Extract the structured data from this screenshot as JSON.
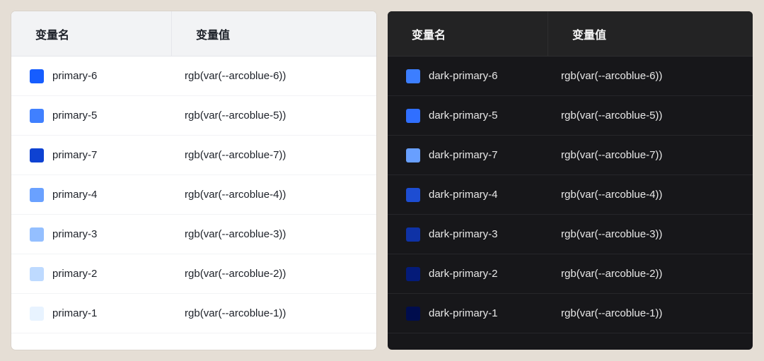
{
  "headers": {
    "var_name": "变量名",
    "var_value": "变量值"
  },
  "light": {
    "rows": [
      {
        "name": "primary-6",
        "value": "rgb(var(--arcoblue-6))",
        "swatch": "#165dff"
      },
      {
        "name": "primary-5",
        "value": "rgb(var(--arcoblue-5))",
        "swatch": "#4080ff"
      },
      {
        "name": "primary-7",
        "value": "rgb(var(--arcoblue-7))",
        "swatch": "#0e42d2"
      },
      {
        "name": "primary-4",
        "value": "rgb(var(--arcoblue-4))",
        "swatch": "#6aa1ff"
      },
      {
        "name": "primary-3",
        "value": "rgb(var(--arcoblue-3))",
        "swatch": "#94bfff"
      },
      {
        "name": "primary-2",
        "value": "rgb(var(--arcoblue-2))",
        "swatch": "#bedaff"
      },
      {
        "name": "primary-1",
        "value": "rgb(var(--arcoblue-1))",
        "swatch": "#e8f3ff"
      }
    ]
  },
  "dark": {
    "rows": [
      {
        "name": "dark-primary-6",
        "value": "rgb(var(--arcoblue-6))",
        "swatch": "#3c7eff"
      },
      {
        "name": "dark-primary-5",
        "value": "rgb(var(--arcoblue-5))",
        "swatch": "#306fff"
      },
      {
        "name": "dark-primary-7",
        "value": "rgb(var(--arcoblue-7))",
        "swatch": "#689fff"
      },
      {
        "name": "dark-primary-4",
        "value": "rgb(var(--arcoblue-4))",
        "swatch": "#1d4dd2"
      },
      {
        "name": "dark-primary-3",
        "value": "rgb(var(--arcoblue-3))",
        "swatch": "#0e32a6"
      },
      {
        "name": "dark-primary-2",
        "value": "rgb(var(--arcoblue-2))",
        "swatch": "#041b79"
      },
      {
        "name": "dark-primary-1",
        "value": "rgb(var(--arcoblue-1))",
        "swatch": "#000d4d"
      }
    ]
  }
}
